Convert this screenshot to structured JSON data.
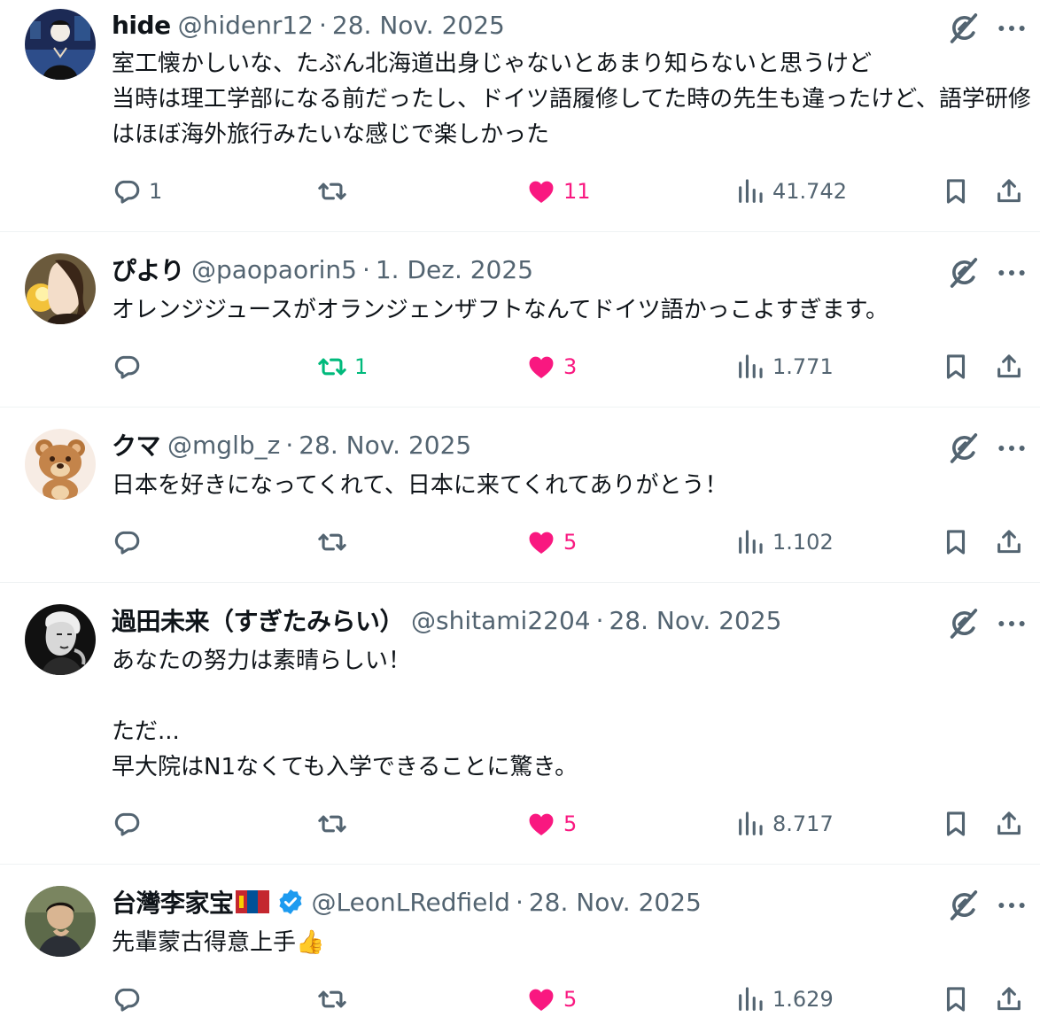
{
  "tweets": [
    {
      "name": "hide",
      "handle": "@hidenr12",
      "sep": "·",
      "date": "28. Nov. 2025",
      "text": "室工懐かしいな、たぶん北海道出身じゃないとあまり知らないと思うけど\n当時は理工学部になる前だったし、ドイツ語履修してた時の先生も違ったけど、語学研修はほぼ海外旅行みたいな感じで楽しかった",
      "replies": "1",
      "retweets": "",
      "likes": "11",
      "views": "41.742"
    },
    {
      "name": "ぴより",
      "handle": "@paopaorin5",
      "sep": "·",
      "date": "1. Dez. 2025",
      "text": "オレンジジュースがオランジェンザフトなんてドイツ語かっこよすぎます。",
      "replies": "",
      "retweets": "1",
      "likes": "3",
      "views": "1.771"
    },
    {
      "name": "クマ",
      "handle": "@mglb_z",
      "sep": "·",
      "date": "28. Nov. 2025",
      "text": "日本を好きになってくれて、日本に来てくれてありがとう！",
      "replies": "",
      "retweets": "",
      "likes": "5",
      "views": "1.102"
    },
    {
      "name": "過田未来（すぎたみらい）",
      "handle": "@shitami2204",
      "sep": "·",
      "date": "28. Nov. 2025",
      "text": "あなたの努力は素晴らしい！\n\nただ...\n早大院はN1なくても入学できることに驚き。",
      "replies": "",
      "retweets": "",
      "likes": "5",
      "views": "8.717"
    },
    {
      "name": "台灣李家宝",
      "handle": "@LeonLRedfield",
      "sep": "·",
      "date": "28. Nov. 2025",
      "text": "先輩蒙古得意上手👍",
      "replies": "",
      "retweets": "",
      "likes": "5",
      "views": "1.629"
    }
  ],
  "icons": {
    "reply": "reply-icon",
    "retweet": "retweet-icon",
    "like": "heart-icon",
    "views": "views-icon",
    "bookmark": "bookmark-icon",
    "share": "share-icon",
    "grok": "grok-icon",
    "more": "more-icon",
    "verified": "verified-badge-icon",
    "flag": "mongolia-flag-icon"
  },
  "colors": {
    "text": "#0f1419",
    "secondary": "#536471",
    "like": "#f91880",
    "retweet_active": "#00ba7c",
    "verified": "#1d9bf0",
    "divider": "#eff3f4"
  }
}
